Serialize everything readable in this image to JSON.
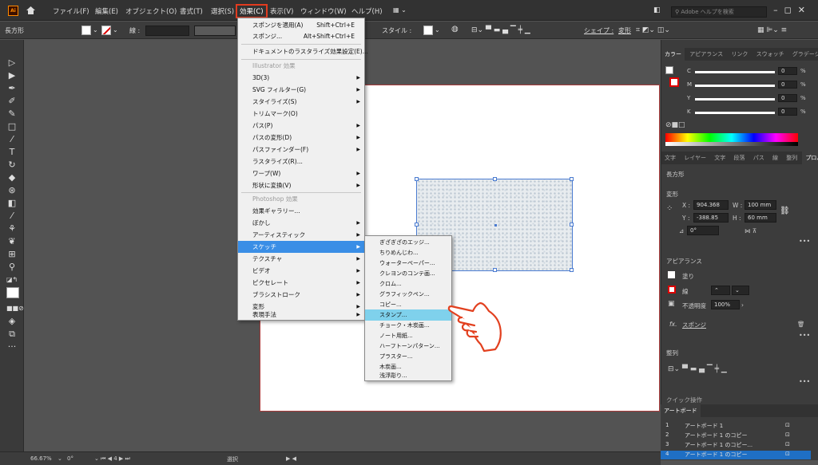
{
  "app": {
    "logo": "Ai"
  },
  "menubar": {
    "items": [
      "ファイル(F)",
      "編集(E)",
      "オブジェクト(O)",
      "書式(T)",
      "選択(S)",
      "効果(C)",
      "表示(V)",
      "ウィンドウ(W)",
      "ヘルプ(H)"
    ],
    "search_placeholder": "Adobe ヘルプを検索"
  },
  "control_bar": {
    "object_type": "長方形",
    "stroke_label": "線 :",
    "style_label": "スタイル :",
    "shape_label": "シェイプ :",
    "transform_label": "変形"
  },
  "effect_menu": {
    "apply_last": {
      "label": "スポンジを適用(A)",
      "shortcut": "Shift+Ctrl+E"
    },
    "last": {
      "label": "スポンジ...",
      "shortcut": "Alt+Shift+Ctrl+E"
    },
    "raster_settings": "ドキュメントのラスタライズ効果設定(E)...",
    "illustrator_header": "Illustrator 効果",
    "illustrator_items": [
      "3D(3)",
      "SVG フィルター(G)",
      "スタイライズ(S)",
      "トリムマーク(O)",
      "パス(P)",
      "パスの変形(D)",
      "パスファインダー(F)",
      "ラスタライズ(R)...",
      "ワープ(W)",
      "形状に変換(V)"
    ],
    "photoshop_header": "Photoshop 効果",
    "photoshop_items": [
      "効果ギャラリー...",
      "ぼかし",
      "アーティスティック",
      "スケッチ",
      "テクスチャ",
      "ビデオ",
      "ピクセレート",
      "ブラシストローク",
      "変形",
      "表現手法"
    ]
  },
  "sketch_submenu": {
    "items": [
      "ぎざぎざのエッジ...",
      "ちりめんじわ...",
      "ウォーターペーパー...",
      "クレヨンのコンテ画...",
      "クロム...",
      "グラフィックペン...",
      "コピー...",
      "スタンプ...",
      "チョーク・木炭画...",
      "ノート用紙...",
      "ハーフトーンパターン...",
      "プラスター...",
      "木炭画...",
      "浅浮彫り..."
    ],
    "highlighted": "スタンプ..."
  },
  "color_panel": {
    "tabs": [
      "カラー",
      "アピアランス",
      "リンク",
      "スウォッチ",
      "グラデーション"
    ],
    "channels": [
      {
        "label": "C",
        "value": "0",
        "unit": "%"
      },
      {
        "label": "M",
        "value": "0",
        "unit": "%"
      },
      {
        "label": "Y",
        "value": "0",
        "unit": "%"
      },
      {
        "label": "K",
        "value": "0",
        "unit": "%"
      }
    ]
  },
  "properties_panel": {
    "tabs": [
      "文字",
      "レイヤー",
      "文字",
      "段落",
      "パス",
      "線",
      "整列",
      "プロパティ"
    ],
    "object_type": "長方形",
    "transform_header": "変形",
    "x_label": "X :",
    "x_value": "904.368",
    "y_label": "Y :",
    "y_value": "-388.85",
    "w_label": "W :",
    "w_value": "100 mm",
    "h_label": "H :",
    "h_value": "60 mm",
    "rotation": "0°",
    "appearance_header": "アピアランス",
    "fill_label": "塗り",
    "stroke_label": "線",
    "opacity_label": "不透明度",
    "opacity_value": "100%",
    "fx_label": "スポンジ",
    "align_header": "整列",
    "quick_actions": "クイック操作"
  },
  "artboards_panel": {
    "title": "アートボード",
    "rows": [
      {
        "num": "1",
        "name": "アートボード 1"
      },
      {
        "num": "2",
        "name": "アートボード 1 のコピー"
      },
      {
        "num": "3",
        "name": "アートボード 1 のコピー..."
      },
      {
        "num": "4",
        "name": "アートボード 1 のコピー"
      }
    ]
  },
  "status_bar": {
    "zoom": "66.67%",
    "rotation": "0°",
    "tool": "選択"
  }
}
